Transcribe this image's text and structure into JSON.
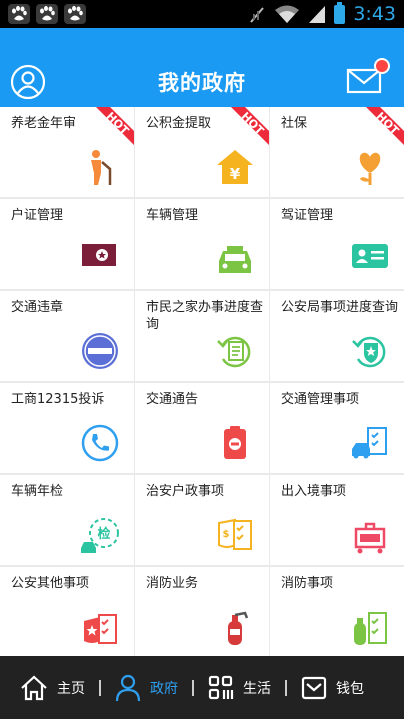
{
  "status_bar": {
    "time": "3:43"
  },
  "header": {
    "title": "我的政府"
  },
  "tiles": [
    {
      "label": "养老金年审",
      "badge": "HOT",
      "icon": "elderly-person-icon",
      "color": "#f58a3b"
    },
    {
      "label": "公积金提取",
      "badge": "HOT",
      "icon": "house-yen-icon",
      "color": "#f5b320"
    },
    {
      "label": "社保",
      "badge": "HOT",
      "icon": "flower-heart-icon",
      "color": "#f5a035"
    },
    {
      "label": "户证管理",
      "icon": "household-id-card-icon",
      "color": "#7a1e3a"
    },
    {
      "label": "车辆管理",
      "icon": "car-icon",
      "color": "#7cc444"
    },
    {
      "label": "驾证管理",
      "icon": "driver-license-icon",
      "color": "#2bc4a0"
    },
    {
      "label": "交通违章",
      "icon": "no-entry-icon",
      "color": "#5b6fd6"
    },
    {
      "label": "市民之家办事进度查询",
      "icon": "document-refresh-icon",
      "color": "#7cc444"
    },
    {
      "label": "公安局事项进度查询",
      "icon": "police-badge-refresh-icon",
      "color": "#2bc4a0"
    },
    {
      "label": "工商12315投诉",
      "icon": "phone-icon",
      "color": "#2f9ff0"
    },
    {
      "label": "交通通告",
      "icon": "traffic-notice-icon",
      "color": "#ee4a4a"
    },
    {
      "label": "交通管理事项",
      "icon": "vehicle-checklist-icon",
      "color": "#2f9ff0"
    },
    {
      "label": "车辆年检",
      "icon": "car-inspection-icon",
      "color": "#2bc4a0"
    },
    {
      "label": "治安户政事项",
      "icon": "shield-checklist-icon",
      "color": "#f5b320"
    },
    {
      "label": "出入境事项",
      "icon": "luggage-icon",
      "color": "#ee4a66"
    },
    {
      "label": "公安其他事项",
      "icon": "star-checklist-icon",
      "color": "#ee4a4a"
    },
    {
      "label": "消防业务",
      "icon": "fire-extinguisher-icon",
      "color": "#d63a3a"
    },
    {
      "label": "消防事项",
      "icon": "extinguisher-checklist-icon",
      "color": "#7cc444"
    }
  ],
  "bottom_nav": [
    {
      "label": "主页",
      "icon": "home-icon",
      "active": false
    },
    {
      "label": "政府",
      "icon": "person-icon",
      "active": true
    },
    {
      "label": "生活",
      "icon": "grid-icon",
      "active": false
    },
    {
      "label": "钱包",
      "icon": "wallet-icon",
      "active": false
    }
  ]
}
